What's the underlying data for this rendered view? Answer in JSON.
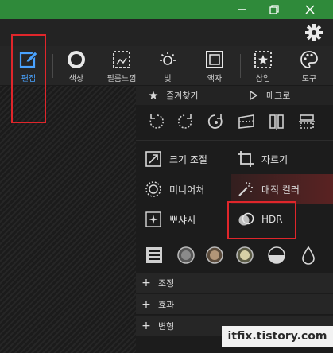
{
  "window": {
    "controls": [
      "minimize-icon",
      "restore-icon",
      "close-icon"
    ]
  },
  "settings": {
    "icon": "gear-icon"
  },
  "toolbar": {
    "items": [
      {
        "label": "편집",
        "icon": "edit-icon",
        "active": true
      },
      {
        "label": "색상",
        "icon": "color-ring-icon"
      },
      {
        "label": "필름느낌",
        "icon": "film-frame-icon"
      },
      {
        "label": "빛",
        "icon": "sun-icon"
      },
      {
        "label": "액자",
        "icon": "frame-icon"
      },
      {
        "label": "삽입",
        "icon": "insert-icon"
      },
      {
        "label": "도구",
        "icon": "palette-icon"
      }
    ]
  },
  "panel": {
    "favorites_label": "즐겨찾기",
    "macro_label": "매크로",
    "rotate_icons": [
      "rotate-left-icon",
      "rotate-right-icon",
      "rotate-free-icon",
      "straighten-icon",
      "flip-horizontal-icon",
      "flip-vertical-icon"
    ],
    "effects": [
      {
        "label": "크기 조절",
        "icon": "resize-icon"
      },
      {
        "label": "자르기",
        "icon": "crop-icon"
      },
      {
        "label": "미니어처",
        "icon": "miniature-icon"
      },
      {
        "label": "매직 컬러",
        "icon": "magic-wand-icon"
      },
      {
        "label": "뽀샤시",
        "icon": "sparkle-icon"
      },
      {
        "label": "HDR",
        "icon": "hdr-icon"
      }
    ],
    "tone_icons": [
      "levels-icon",
      "tone-gray-icon",
      "tone-brown-icon",
      "tone-yellow-icon",
      "half-circle-icon",
      "drop-icon"
    ],
    "sections": [
      "조정",
      "효과",
      "변형"
    ]
  },
  "watermark": "itfix.tistory.com",
  "colors": {
    "titlebar": "#2f8a3a",
    "accent_blue": "#4aa3ff",
    "highlight_red": "#e0262b"
  }
}
